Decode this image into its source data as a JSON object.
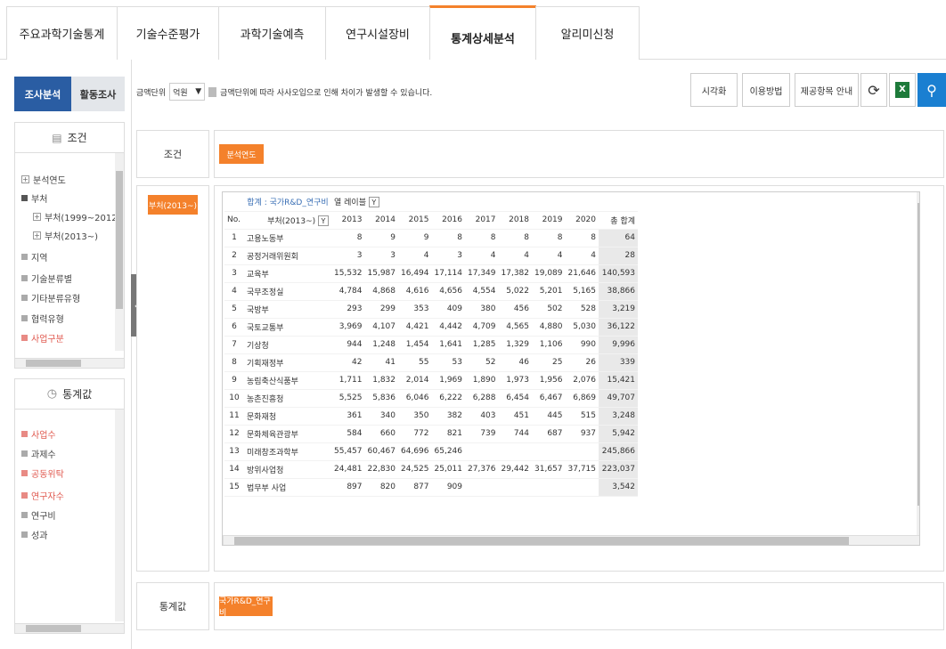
{
  "tabs": [
    "주요과학기술통계",
    "기술수준평가",
    "과학기술예측",
    "연구시설장비",
    "통계상세분석",
    "알리미신청"
  ],
  "left": {
    "btn_analysis": "조사분석",
    "btn_activity": "활동조사",
    "cond_header": "조건",
    "cond_items": [
      "분석연도",
      "부처",
      "부처(1999~2012)",
      "부처(2013~)",
      "지역",
      "기술분류별",
      "기타분류유형",
      "협력유형",
      "사업구분"
    ],
    "stat_header": "통계값",
    "stat_items": [
      "사업수",
      "과제수",
      "공동위탁",
      "연구자수",
      "연구비",
      "성과"
    ]
  },
  "toolbar": {
    "unit_label": "금액단위",
    "unit_value": "억원",
    "note": "금액단위에 따라 사사오입으로 인해 차이가 발생할 수 있습니다.",
    "btn_visual": "시각화",
    "btn_howto": "이용방법",
    "btn_items": "제공항목 안내"
  },
  "condition": {
    "label": "조건",
    "chip": "분석연도"
  },
  "row_chip": "부처(2013~)",
  "grid": {
    "sum_label": "합계 : 국가R&D_연구비",
    "col_label": "열 레이블",
    "no_header": "No.",
    "dept_header": "부처(2013~)",
    "years": [
      "2013",
      "2014",
      "2015",
      "2016",
      "2017",
      "2018",
      "2019",
      "2020"
    ],
    "total_header": "총 합계",
    "rows": [
      {
        "no": "1",
        "name": "고용노동부",
        "v": [
          "8",
          "9",
          "9",
          "8",
          "8",
          "8",
          "8",
          "8"
        ],
        "t": "64"
      },
      {
        "no": "2",
        "name": "공정거래위원회",
        "v": [
          "3",
          "3",
          "4",
          "3",
          "4",
          "4",
          "4",
          "4"
        ],
        "t": "28"
      },
      {
        "no": "3",
        "name": "교육부",
        "v": [
          "15,532",
          "15,987",
          "16,494",
          "17,114",
          "17,349",
          "17,382",
          "19,089",
          "21,646"
        ],
        "t": "140,593"
      },
      {
        "no": "4",
        "name": "국무조정실",
        "v": [
          "4,784",
          "4,868",
          "4,616",
          "4,656",
          "4,554",
          "5,022",
          "5,201",
          "5,165"
        ],
        "t": "38,866"
      },
      {
        "no": "5",
        "name": "국방부",
        "v": [
          "293",
          "299",
          "353",
          "409",
          "380",
          "456",
          "502",
          "528"
        ],
        "t": "3,219"
      },
      {
        "no": "6",
        "name": "국토교통부",
        "v": [
          "3,969",
          "4,107",
          "4,421",
          "4,442",
          "4,709",
          "4,565",
          "4,880",
          "5,030"
        ],
        "t": "36,122"
      },
      {
        "no": "7",
        "name": "기상청",
        "v": [
          "944",
          "1,248",
          "1,454",
          "1,641",
          "1,285",
          "1,329",
          "1,106",
          "990"
        ],
        "t": "9,996"
      },
      {
        "no": "8",
        "name": "기획재정부",
        "v": [
          "42",
          "41",
          "55",
          "53",
          "52",
          "46",
          "25",
          "26"
        ],
        "t": "339"
      },
      {
        "no": "9",
        "name": "농림축산식품부",
        "v": [
          "1,711",
          "1,832",
          "2,014",
          "1,969",
          "1,890",
          "1,973",
          "1,956",
          "2,076"
        ],
        "t": "15,421"
      },
      {
        "no": "10",
        "name": "농촌진흥청",
        "v": [
          "5,525",
          "5,836",
          "6,046",
          "6,222",
          "6,288",
          "6,454",
          "6,467",
          "6,869"
        ],
        "t": "49,707"
      },
      {
        "no": "11",
        "name": "문화재청",
        "v": [
          "361",
          "340",
          "350",
          "382",
          "403",
          "451",
          "445",
          "515"
        ],
        "t": "3,248"
      },
      {
        "no": "12",
        "name": "문화체육관광부",
        "v": [
          "584",
          "660",
          "772",
          "821",
          "739",
          "744",
          "687",
          "937"
        ],
        "t": "5,942"
      },
      {
        "no": "13",
        "name": "미래창조과학부",
        "v": [
          "55,457",
          "60,467",
          "64,696",
          "65,246",
          "",
          "",
          "",
          ""
        ],
        "t": "245,866"
      },
      {
        "no": "14",
        "name": "방위사업청",
        "v": [
          "24,481",
          "22,830",
          "24,525",
          "25,011",
          "27,376",
          "29,442",
          "31,657",
          "37,715"
        ],
        "t": "223,037"
      },
      {
        "no": "15",
        "name": "법무부 사업",
        "v": [
          "897",
          "820",
          "877",
          "909",
          "",
          "",
          "",
          ""
        ],
        "t": "3,542"
      }
    ]
  },
  "stat": {
    "label": "통계값",
    "chip": "국가R&D_연구비"
  }
}
